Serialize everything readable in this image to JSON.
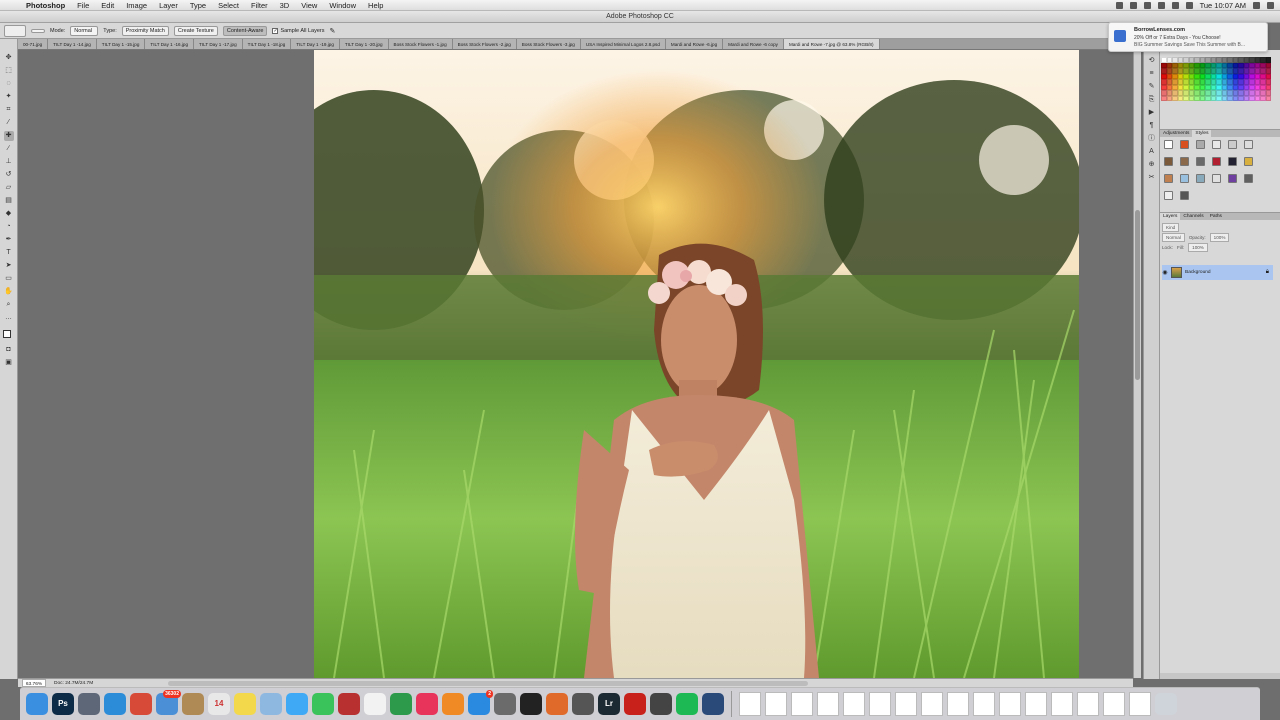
{
  "menubar": {
    "app": "Photoshop",
    "items": [
      "File",
      "Edit",
      "Image",
      "Layer",
      "Type",
      "Select",
      "Filter",
      "3D",
      "View",
      "Window",
      "Help"
    ],
    "clock": "Tue 10:07 AM"
  },
  "window": {
    "title": "Adobe Photoshop CC"
  },
  "options": {
    "mode_label": "Mode:",
    "mode_value": "Normal",
    "type_label": "Type:",
    "type_buttons": [
      "Proximity Match",
      "Create Texture",
      "Content-Aware"
    ],
    "active_type": "Content-Aware",
    "sample_all_layers": "Sample All Layers"
  },
  "tabs": [
    "00-71.jpg",
    "TILT Day 1 -14.jpg",
    "TILT Day 1 -15.jpg",
    "TILT Day 1 -16.jpg",
    "TILT Day 1 -17.jpg",
    "TILT Day 1 -18.jpg",
    "TILT Day 1 -19.jpg",
    "TILT Day 1 -20.jpg",
    "Boss Stock Flowers -1.jpg",
    "Boss Stock Flowers -2.jpg",
    "Boss Stock Flowers -3.jpg",
    "USA Inspired Minimal Logos 2.8.psd",
    "Mardi and Rowe -6.jpg",
    "Mardi and Rowe -6 copy",
    "Mardi and Rowe -7.jpg @ 63.8% (RGB/8)"
  ],
  "status": {
    "zoom": "63.76%",
    "doc": "Doc: 24.7M/24.7M"
  },
  "notification": {
    "sender": "BorrowLenses.com",
    "line1": "20% Off or 7 Extra Days - You Choose!",
    "line2": "BIG Summer Savings Save This Summer with B..."
  },
  "panels": {
    "adjust_tabs": [
      "Adjustments",
      "Styles"
    ],
    "layer_tabs": [
      "Layers",
      "Channels",
      "Paths"
    ],
    "kind_label": "Kind",
    "blend_mode": "Normal",
    "opacity_label": "Opacity:",
    "opacity_value": "100%",
    "lock_label": "Lock:",
    "fill_label": "Fill:",
    "fill_value": "100%",
    "layer_name": "Background"
  },
  "dock": {
    "apps": [
      {
        "name": "Finder",
        "label": "",
        "color": "#3b8fe0"
      },
      {
        "name": "Photoshop",
        "label": "Ps",
        "color": "#0d2b47"
      },
      {
        "name": "Launchpad",
        "label": "",
        "color": "#5d6778"
      },
      {
        "name": "Safari",
        "label": "",
        "color": "#2d8cd8"
      },
      {
        "name": "Chrome",
        "label": "",
        "color": "#d84a38"
      },
      {
        "name": "Mail",
        "label": "",
        "color": "#4b8fd6",
        "badge": "36302"
      },
      {
        "name": "Contacts",
        "label": "",
        "color": "#b08a55"
      },
      {
        "name": "Calendar",
        "label": "14",
        "color": "#e8e8e8"
      },
      {
        "name": "Notes",
        "label": "",
        "color": "#f2d84a"
      },
      {
        "name": "Preview",
        "label": "",
        "color": "#8fb8e0"
      },
      {
        "name": "Messages",
        "label": "",
        "color": "#3fa9f5"
      },
      {
        "name": "FaceTime",
        "label": "",
        "color": "#39c35a"
      },
      {
        "name": "Photo Booth",
        "label": "",
        "color": "#b83030"
      },
      {
        "name": "Photos",
        "label": "",
        "color": "#f2f2f2"
      },
      {
        "name": "Numbers",
        "label": "",
        "color": "#2c9a4a"
      },
      {
        "name": "iTunes",
        "label": "",
        "color": "#e8335a"
      },
      {
        "name": "iBooks",
        "label": "",
        "color": "#f08a24"
      },
      {
        "name": "App Store",
        "label": "",
        "color": "#2a8ae0",
        "badge": "2"
      },
      {
        "name": "System Preferences",
        "label": "",
        "color": "#6b6b6b"
      },
      {
        "name": "Premiere",
        "label": "",
        "color": "#222"
      },
      {
        "name": "Keynote",
        "label": "",
        "color": "#e06a2a"
      },
      {
        "name": "Image Capture",
        "label": "",
        "color": "#555"
      },
      {
        "name": "Lightroom",
        "label": "Lr",
        "color": "#1c2a33"
      },
      {
        "name": "Acrobat",
        "label": "",
        "color": "#c8201a"
      },
      {
        "name": "Calculator",
        "label": "",
        "color": "#444"
      },
      {
        "name": "Spotify",
        "label": "",
        "color": "#1db954"
      },
      {
        "name": "QuickTime",
        "label": "",
        "color": "#2a4a7a"
      }
    ],
    "doc_count": 16
  }
}
